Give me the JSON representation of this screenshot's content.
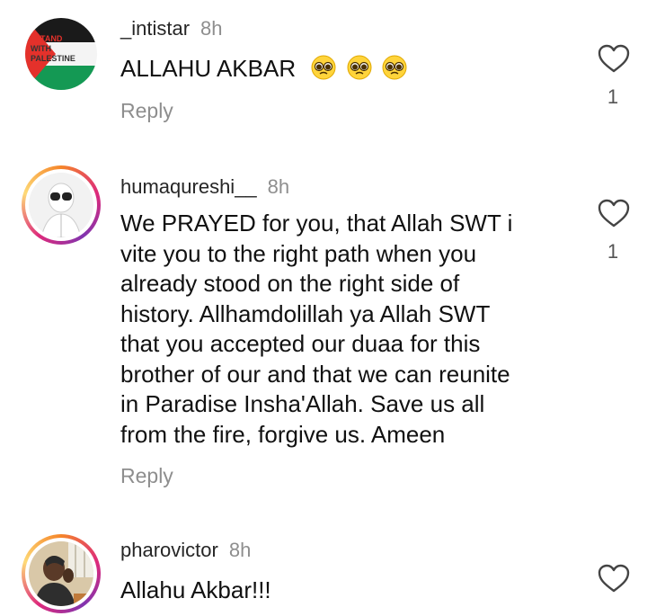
{
  "comments": [
    {
      "username": "_intistar",
      "time": "8h",
      "text": "ALLAHU AKBAR",
      "emoji_count": 3,
      "emoji_icon": "pleading-face-icon",
      "reply_label": "Reply",
      "like_count": "1",
      "avatar_text": [
        "I STAND",
        "WITH",
        "PALESTINE"
      ]
    },
    {
      "username": "humaqureshi__",
      "time": "8h",
      "text_lines": [
        "We PRAYED for you, that Allah SWT i",
        "vite you to the right path when you",
        "already stood on the right side of",
        "history. Allhamdolillah ya Allah SWT",
        "that you accepted our duaa for this",
        "brother of our and that we can reunite",
        "in Paradise Insha'Allah. Save us all",
        "from the fire, forgive us. Ameen"
      ],
      "reply_label": "Reply",
      "like_count": "1",
      "has_story_ring": true
    },
    {
      "username": "pharovictor",
      "time": "8h",
      "text": "Allahu Akbar!!!",
      "has_story_ring": true
    }
  ],
  "colors": {
    "meta_gray": "#8e8e8e",
    "text": "#111111",
    "flag_black": "#000000",
    "flag_green": "#149954",
    "flag_red": "#e4312b"
  }
}
